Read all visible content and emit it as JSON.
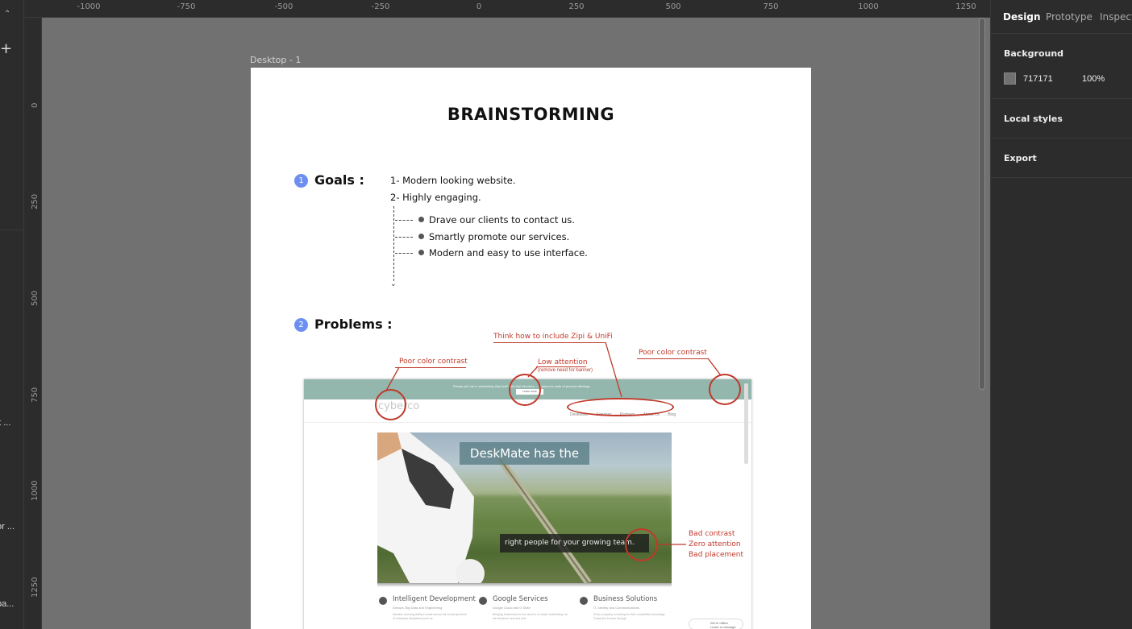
{
  "left_sidebar": {
    "items": [
      "'t ...",
      "or ...",
      "ba..."
    ]
  },
  "ruler_top": [
    "-1000",
    "-750",
    "-500",
    "-250",
    "0",
    "250",
    "500",
    "750",
    "1000",
    "1250"
  ],
  "ruler_left": [
    "0",
    "250",
    "500",
    "750",
    "1000",
    "1250"
  ],
  "frame": {
    "label": "Desktop - 1",
    "title": "BRAINSTORMING",
    "goals": {
      "number": "1",
      "heading": "Goals :",
      "lines": [
        "1- Modern looking website.",
        "2- Highly engaging."
      ],
      "bullets": [
        "Drave our clients to contact us.",
        "Smartly promote our services.",
        "Modern and easy to use interface."
      ]
    },
    "problems": {
      "number": "2",
      "heading": "Problems :",
      "annotations": {
        "zipi": "Think how to include Zipi & UniFi",
        "contrast_left": "Poor color contrast",
        "low_attention": "Low attention",
        "low_attention_sub": "(remove need for banner)",
        "contrast_right": "Poor color contrast",
        "bad_contrast": "Bad contrast",
        "zero_attention": "Zero attention",
        "bad_placement": "Bad placement"
      }
    },
    "site": {
      "topbar_message": "Please join me in welcoming Zipi-UniFi and Zipi-Services — Cyberco's suite of product offerings.",
      "topbar_button": "Learn more",
      "logo": "cyberco",
      "nav": [
        "DeskMate",
        "Services",
        "Partners",
        "About Us",
        "Blog"
      ],
      "hero_caption_top": "DeskMate has the",
      "hero_caption_bottom": "right people for your growing team.",
      "services": [
        {
          "title": "Intelligent Development",
          "subtitle": "Devops, Big Data and Engineering",
          "text": "Machine learning ability to scale across the broad spectrum of enterprise disciplines such as"
        },
        {
          "title": "Google Services",
          "subtitle": "Google Cloud and G Suite",
          "text": "Bringing businesses to the cloud is no small undertaking. As we introduce new and ever"
        },
        {
          "title": "Business Solutions",
          "subtitle": "IT, Identity and Communications",
          "text": "Every company is looking for their competitive advantage. Today this is done through"
        }
      ],
      "offline_title": "We're offline",
      "offline_sub": "Leave a message"
    }
  },
  "right_panel": {
    "tabs": [
      "Design",
      "Prototype",
      "Inspect"
    ],
    "background_heading": "Background",
    "background_hex": "717171",
    "background_opacity": "100%",
    "local_styles": "Local styles",
    "export": "Export"
  },
  "colors": {
    "canvas": "#717171",
    "annotation": "#c0392b",
    "section_badge": "#6d8ff0",
    "site_topbar": "#93b6ad"
  }
}
